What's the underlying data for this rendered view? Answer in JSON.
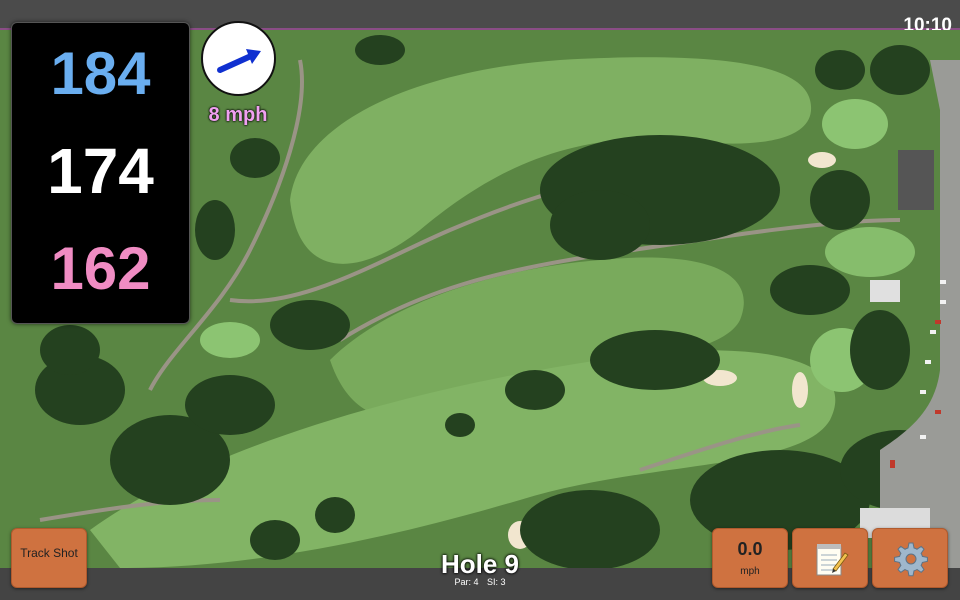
{
  "status": {
    "time": "10:10"
  },
  "distances": {
    "back": "184",
    "middle": "174",
    "front": "162"
  },
  "wind": {
    "speed_label": "8 mph",
    "arrow_icon": "wind-arrow-icon",
    "arrow_color": "#1030d0"
  },
  "hole": {
    "title": "Hole 9",
    "par": "Par: 4",
    "si": "SI: 3"
  },
  "buttons": {
    "track_shot_label": "Track Shot",
    "speed_value": "0.0",
    "speed_unit": "mph",
    "notes_icon": "notepad-icon",
    "settings_icon": "gear-icon"
  },
  "colors": {
    "back": "#6aaef0",
    "middle": "#ffffff",
    "front": "#f08cc3",
    "button": "#cf7240",
    "wind_label": "#f0a0f0"
  }
}
